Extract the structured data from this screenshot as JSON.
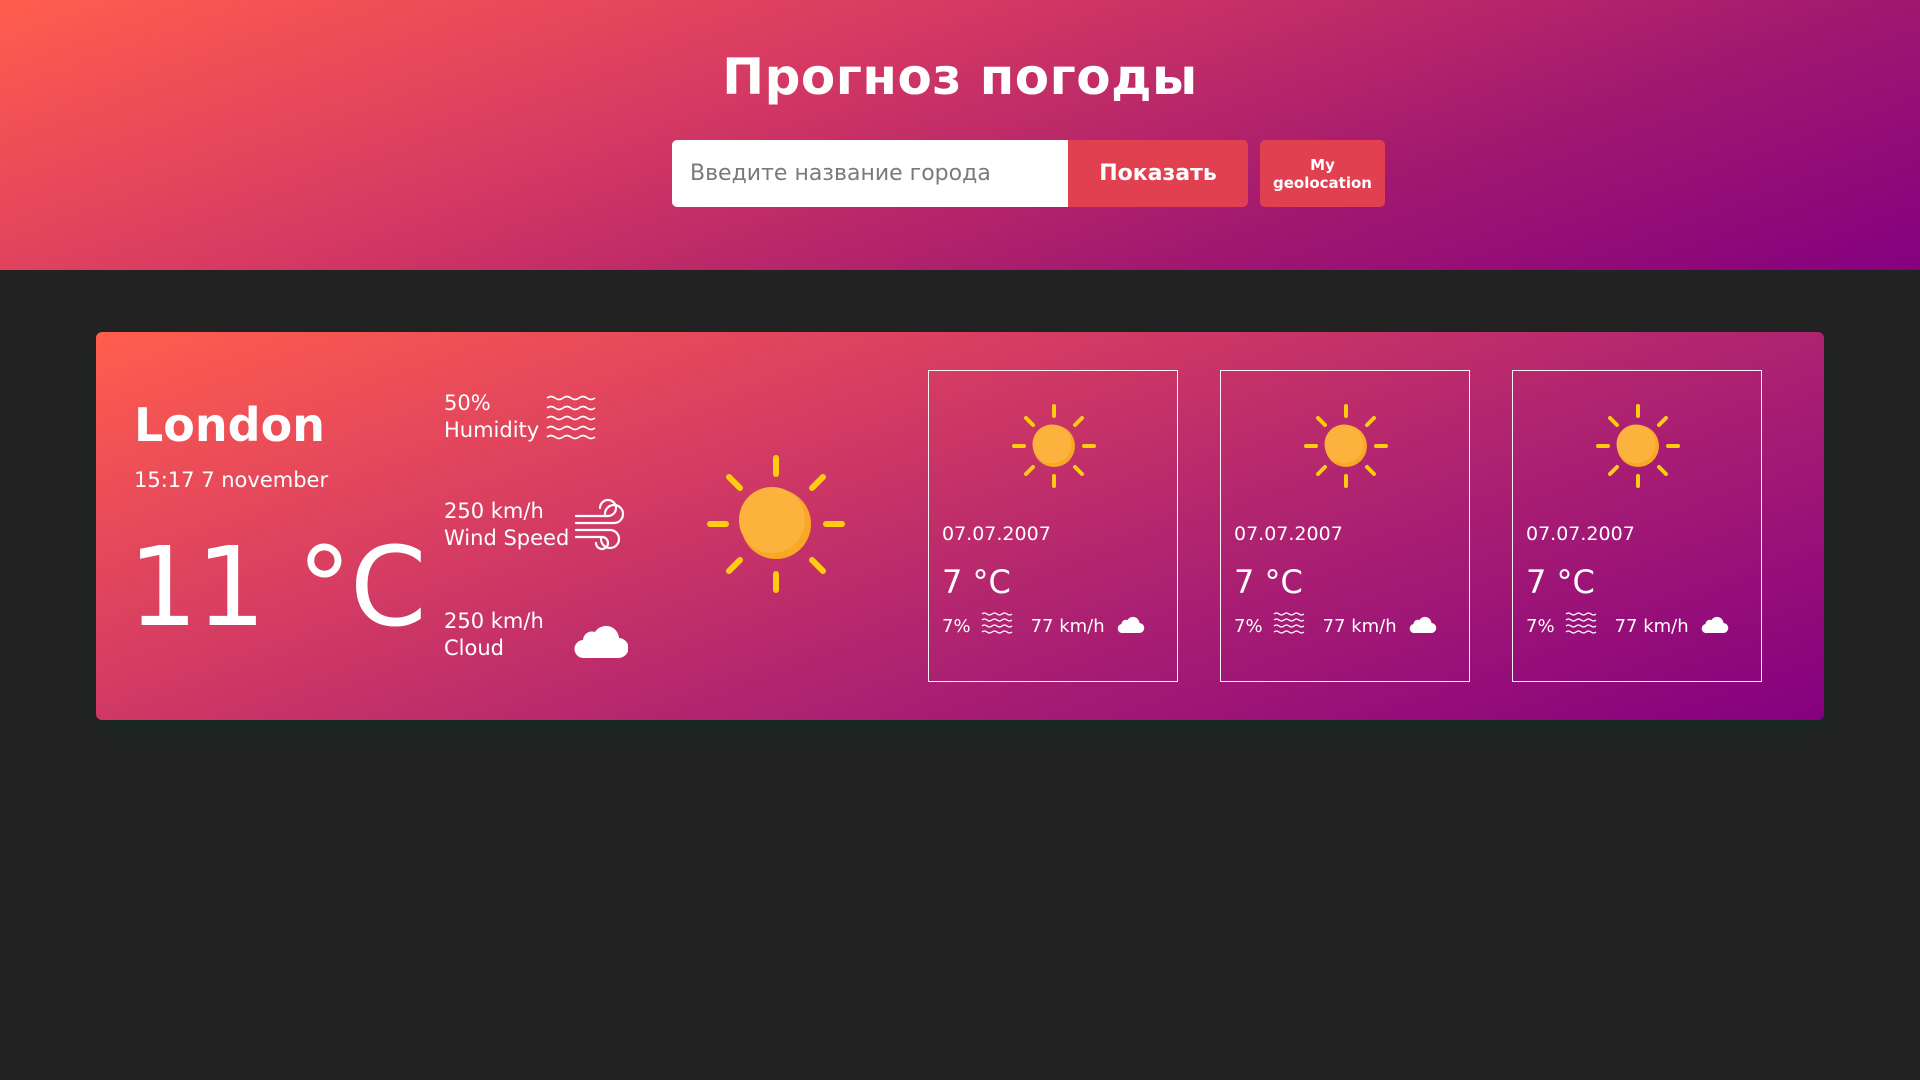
{
  "header": {
    "title": "Прогноз погоды",
    "search": {
      "placeholder": "Введите название города",
      "value": ""
    },
    "show_button_label": "Показать",
    "geo_button_label": "My geolocation"
  },
  "current": {
    "city": "London",
    "datetime": "15:17 7 november",
    "temperature": "11 °C",
    "condition_icon": "sun-icon",
    "stats": [
      {
        "value": "50%",
        "label": "Humidity",
        "icon": "humidity-icon"
      },
      {
        "value": "250 km/h",
        "label": "Wind Speed",
        "icon": "wind-icon"
      },
      {
        "value": "250 km/h",
        "label": "Cloud",
        "icon": "cloud-icon"
      }
    ]
  },
  "forecast": [
    {
      "date": "07.07.2007",
      "temperature": "7 °C",
      "humidity": "7%",
      "wind": "77 km/h",
      "icon": "sun-icon"
    },
    {
      "date": "07.07.2007",
      "temperature": "7 °C",
      "humidity": "7%",
      "wind": "77 km/h",
      "icon": "sun-icon"
    },
    {
      "date": "07.07.2007",
      "temperature": "7 °C",
      "humidity": "7%",
      "wind": "77 km/h",
      "icon": "sun-icon"
    }
  ],
  "colors": {
    "background": "#222222",
    "gradient_start": "#ff5e4d",
    "gradient_end": "#84007f",
    "button": "#e0404f",
    "sun": "#fbb33d",
    "sun_rays": "#ffcc10"
  }
}
